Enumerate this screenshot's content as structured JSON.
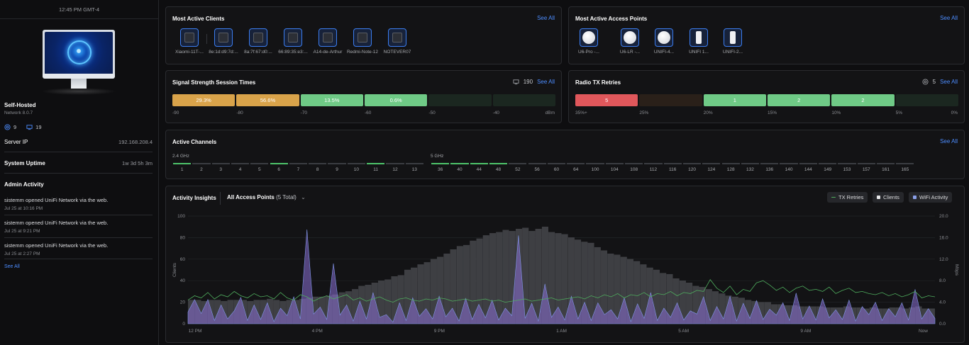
{
  "sidebar": {
    "time": "12:45 PM GMT-4",
    "title": "Self-Hosted",
    "subtitle": "Network 8.0.7",
    "stat_aps": "9",
    "stat_clients": "19",
    "server_ip_label": "Server IP",
    "server_ip": "192.168.208.4",
    "uptime_label": "System Uptime",
    "uptime": "1w 3d 5h 3m",
    "admin_title": "Admin Activity",
    "activity": [
      {
        "text": "sistemm opened UniFi Network via the web.",
        "date": "Jul 25 at 10:16 PM"
      },
      {
        "text": "sistemm opened UniFi Network via the web.",
        "date": "Jul 25 at 9:21 PM"
      },
      {
        "text": "sistemm opened UniFi Network via the web.",
        "date": "Jul 25 at 2:27 PM"
      }
    ],
    "see_all": "See All"
  },
  "clients": {
    "title": "Most Active Clients",
    "see_all": "See All",
    "items": [
      "Xiaomi-11T-...",
      "8e:1d:d9:7d:...",
      "8a:7f:67:d0:...",
      "66:89:35:e3:...",
      "A14-de-Arthur",
      "Redmi-Note-12",
      "NOTEVER07"
    ]
  },
  "aps": {
    "title": "Most Active Access Points",
    "see_all": "See All",
    "items": [
      {
        "label": "U6-Pro -...",
        "icon": "round-ap-icon"
      },
      {
        "label": "U6-LR -...",
        "icon": "round-ap-icon"
      },
      {
        "label": "UNIFI-4...",
        "icon": "round-ap-icon"
      },
      {
        "label": "UNIFI 1...",
        "icon": "wall-ap-icon"
      },
      {
        "label": "UNIFI-2...",
        "icon": "wall-ap-icon"
      }
    ]
  },
  "signal": {
    "title": "Signal Strength Session Times",
    "count": "190",
    "see_all": "See All",
    "segments": [
      {
        "label": "29.3%",
        "color": "#d9a34a"
      },
      {
        "label": "56.6%",
        "color": "#d9a34a"
      },
      {
        "label": "13.5%",
        "color": "#6fca86"
      },
      {
        "label": "0.6%",
        "color": "#6fca86"
      },
      {
        "label": "",
        "color": "#1b2720"
      },
      {
        "label": "",
        "color": "#1b2720"
      }
    ],
    "ticks": [
      "-90",
      "-80",
      "-70",
      "-60",
      "-50",
      "-40",
      "dBm"
    ]
  },
  "radio": {
    "title": "Radio TX Retries",
    "count": "5",
    "see_all": "See All",
    "segments": [
      {
        "label": "5",
        "color": "#e0575b"
      },
      {
        "label": "",
        "color": "#2a2019"
      },
      {
        "label": "1",
        "color": "#6fca86"
      },
      {
        "label": "2",
        "color": "#6fca86"
      },
      {
        "label": "2",
        "color": "#6fca86"
      },
      {
        "label": "",
        "color": "#1b2720"
      }
    ],
    "ticks": [
      "35%+",
      "25%",
      "20%",
      "15%",
      "10%",
      "5%",
      "0%"
    ]
  },
  "channels": {
    "title": "Active Channels",
    "see_all": "See All",
    "band24": "2.4 GHz",
    "band5": "5 GHz",
    "ch24": [
      "1",
      "2",
      "3",
      "4",
      "5",
      "6",
      "7",
      "8",
      "9",
      "10",
      "11",
      "12",
      "13"
    ],
    "ch24_active": [
      "1",
      "6",
      "11"
    ],
    "ch5": [
      "36",
      "40",
      "44",
      "48",
      "52",
      "56",
      "60",
      "64",
      "100",
      "104",
      "108",
      "112",
      "116",
      "120",
      "124",
      "128",
      "132",
      "136",
      "140",
      "144",
      "149",
      "153",
      "157",
      "161",
      "165"
    ],
    "ch5_active": [
      "36",
      "40",
      "44",
      "48"
    ]
  },
  "insights": {
    "title": "Activity Insights",
    "ap_filter": "All Access Points",
    "ap_count": "(5 Total)",
    "legend_tx": "TX Retries",
    "legend_clients": "Clients",
    "legend_wifi": "WiFi Activity"
  },
  "colors": {
    "accent": "#4d8dff",
    "clients_bar": "#4a4a4e",
    "wifi": "#8a6fd6",
    "tx": "#4fae5e"
  },
  "chart_data": {
    "type": "bar",
    "ylabel": "Clients",
    "y2label": "Mbps",
    "ylim": [
      0,
      100
    ],
    "y2lim": [
      0,
      20
    ],
    "y_ticks": [
      "0",
      "20",
      "40",
      "60",
      "80",
      "100"
    ],
    "y2_ticks": [
      "0.0",
      "4.0",
      "8.0",
      "12.0",
      "16.0",
      "20.0"
    ],
    "x_ticks": [
      "12 PM",
      "4 PM",
      "9 PM",
      "1 AM",
      "5 AM",
      "9 AM",
      "Now"
    ],
    "clients": [
      22,
      22,
      21,
      22,
      22,
      21,
      22,
      22,
      22,
      21,
      22,
      22,
      23,
      22,
      21,
      22,
      22,
      23,
      24,
      25,
      25,
      26,
      27,
      29,
      30,
      32,
      35,
      36,
      38,
      40,
      41,
      44,
      45,
      50,
      52,
      55,
      57,
      60,
      62,
      65,
      69,
      72,
      73,
      77,
      79,
      82,
      84,
      85,
      87,
      86,
      88,
      89,
      86,
      88,
      90,
      85,
      84,
      83,
      80,
      78,
      76,
      75,
      71,
      68,
      65,
      64,
      62,
      60,
      58,
      55,
      52,
      50,
      47,
      46,
      42,
      40,
      38,
      35,
      34,
      32,
      30,
      28,
      26,
      25,
      24,
      22,
      21,
      20,
      20,
      18,
      18,
      17,
      17,
      16,
      16,
      16,
      16,
      15,
      15,
      15,
      16,
      15,
      15,
      14,
      15,
      14,
      14,
      15,
      15,
      14,
      15,
      16,
      14,
      14
    ],
    "wifi_mbps": [
      2.2,
      4.5,
      1.9,
      4.5,
      0.6,
      3.5,
      0.9,
      2.4,
      4.9,
      0.6,
      3.5,
      0.8,
      3.9,
      0.4,
      2.9,
      1.5,
      5.0,
      0.9,
      17.5,
      1.8,
      3.1,
      0.8,
      11.2,
      1.6,
      3.5,
      0.5,
      4.2,
      0.9,
      5.8,
      1.2,
      1.7,
      0.3,
      3.9,
      0.6,
      4.8,
      1.4,
      2.8,
      0.9,
      5.1,
      1.3,
      2.9,
      0.5,
      4.7,
      0.8,
      3.6,
      1.1,
      4.4,
      0.7,
      2.9,
      1.5,
      16.4,
      1.0,
      3.8,
      0.5,
      7.4,
      1.2,
      3.1,
      0.7,
      5.1,
      0.9,
      4.0,
      0.6,
      3.9,
      1.7,
      2.6,
      0.9,
      4.8,
      0.4,
      3.7,
      1.0,
      5.8,
      0.6,
      2.9,
      1.2,
      3.9,
      0.7,
      2.4,
      1.8,
      5.0,
      0.6,
      3.2,
      0.9,
      5.1,
      0.5,
      3.8,
      1.0,
      4.3,
      0.8,
      2.7,
      1.6,
      3.9,
      0.6,
      5.7,
      0.9,
      3.3,
      0.7,
      4.6,
      1.1,
      2.6,
      0.8,
      4.4,
      0.5,
      3.2,
      1.7,
      4.0,
      0.6,
      2.8,
      1.3,
      3.9,
      0.7,
      6.4,
      0.9,
      2.8,
      1.0
    ],
    "tx_retries": [
      22,
      26,
      24,
      29,
      23,
      27,
      25,
      30,
      26,
      24,
      28,
      25,
      26,
      23,
      29,
      24,
      22,
      27,
      25,
      21,
      24,
      26,
      23,
      25,
      27,
      22,
      24,
      21,
      23,
      25,
      22,
      20,
      23,
      24,
      22,
      21,
      23,
      22,
      24,
      23,
      21,
      22,
      23,
      21,
      22,
      23,
      21,
      22,
      20,
      21,
      22,
      23,
      21,
      22,
      23,
      24,
      22,
      23,
      24,
      25,
      23,
      26,
      24,
      27,
      25,
      28,
      24,
      27,
      26,
      29,
      25,
      28,
      27,
      30,
      26,
      29,
      28,
      31,
      30,
      41,
      33,
      29,
      35,
      27,
      32,
      30,
      38,
      40,
      36,
      31,
      34,
      29,
      33,
      35,
      31,
      32,
      30,
      34,
      28,
      31,
      33,
      29,
      30,
      28,
      27,
      29,
      26,
      28,
      25,
      27,
      30,
      24,
      26,
      25
    ]
  }
}
